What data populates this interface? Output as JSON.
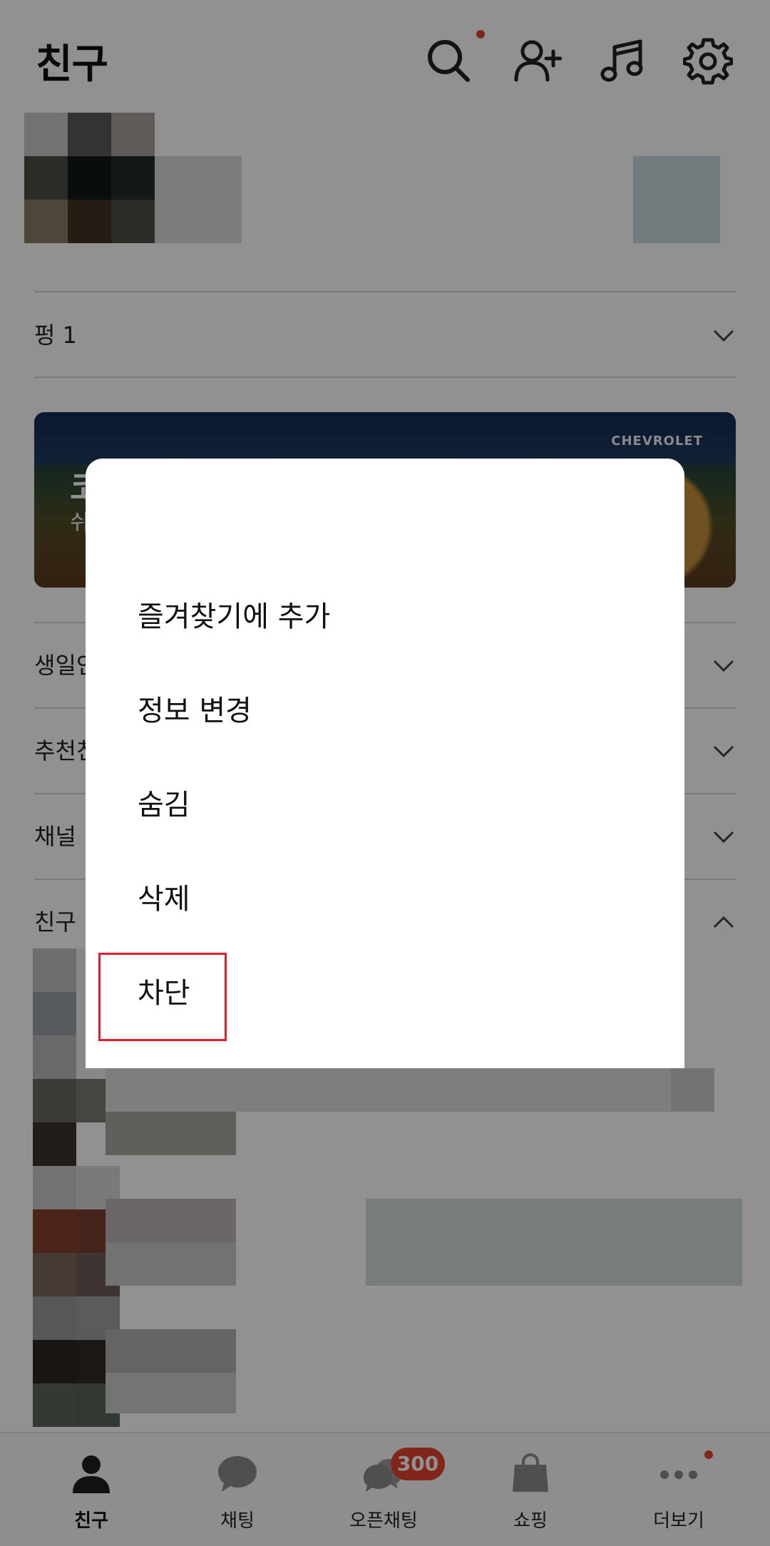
{
  "header": {
    "title": "친구",
    "icons": [
      "search-icon",
      "add-friend-icon",
      "music-icon",
      "settings-icon"
    ]
  },
  "sections": {
    "group": {
      "label": "펑 1"
    },
    "birthday": {
      "label": "생일인"
    },
    "recommend": {
      "label": "추천친"
    },
    "channel": {
      "label": "채널"
    },
    "friends": {
      "label": "친구"
    }
  },
  "banner": {
    "brand": "CHEVROLET",
    "title_partial": "코",
    "subtitle_partial": "쉬"
  },
  "dialog": {
    "items": [
      {
        "label": "즐겨찾기에 추가"
      },
      {
        "label": "정보 변경"
      },
      {
        "label": "숨김"
      },
      {
        "label": "삭제"
      },
      {
        "label": "차단"
      }
    ]
  },
  "bottom_nav": {
    "items": [
      {
        "label": "친구",
        "icon": "person-icon"
      },
      {
        "label": "채팅",
        "icon": "chat-bubble-icon"
      },
      {
        "label": "오픈채팅",
        "icon": "open-chat-icon"
      },
      {
        "label": "쇼핑",
        "icon": "shopping-bag-icon"
      },
      {
        "label": "더보기",
        "icon": "more-icon"
      }
    ],
    "open_chat_badge": "300"
  },
  "colors": {
    "accent": "#e2462c",
    "highlight_box": "#e31e2a",
    "scrim": "rgba(0,0,0,0.43)"
  }
}
